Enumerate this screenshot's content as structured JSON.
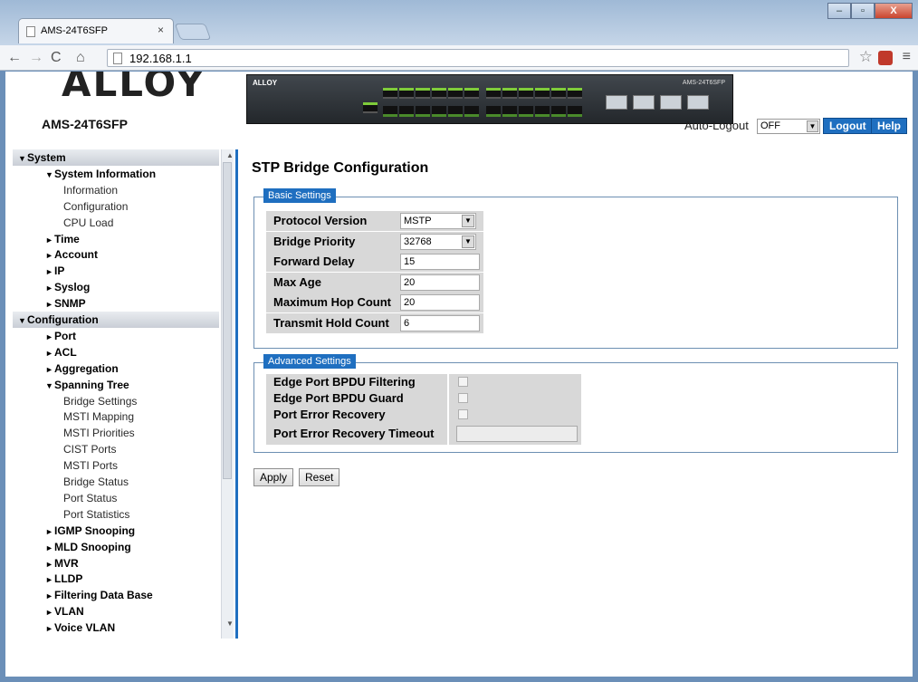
{
  "browser": {
    "tab_title": "AMS-24T6SFP",
    "tab_close": "×",
    "url": "192.168.1.1",
    "window_buttons": [
      "–",
      "▫",
      "X"
    ]
  },
  "header": {
    "logo_text": "ALLOY",
    "model": "AMS-24T6SFP",
    "device_logo": "ALLOY",
    "device_model": "AMS-24T6SFP",
    "auto_logout_label": "Auto-Logout",
    "auto_logout_value": "OFF",
    "logout_label": "Logout",
    "help_label": "Help"
  },
  "sidebar": {
    "items": [
      {
        "label": "System",
        "level": 0,
        "arrow": "▼"
      },
      {
        "label": "System Information",
        "level": 1,
        "arrow": "▼"
      },
      {
        "label": "Information",
        "level": 2,
        "arrow": ""
      },
      {
        "label": "Configuration",
        "level": 2,
        "arrow": ""
      },
      {
        "label": "CPU Load",
        "level": 2,
        "arrow": ""
      },
      {
        "label": "Time",
        "level": 1,
        "arrow": "►"
      },
      {
        "label": "Account",
        "level": 1,
        "arrow": "►"
      },
      {
        "label": "IP",
        "level": 1,
        "arrow": "►"
      },
      {
        "label": "Syslog",
        "level": 1,
        "arrow": "►"
      },
      {
        "label": "SNMP",
        "level": 1,
        "arrow": "►"
      },
      {
        "label": "Configuration",
        "level": 0,
        "arrow": "▼"
      },
      {
        "label": "Port",
        "level": 1,
        "arrow": "►"
      },
      {
        "label": "ACL",
        "level": 1,
        "arrow": "►"
      },
      {
        "label": "Aggregation",
        "level": 1,
        "arrow": "►"
      },
      {
        "label": "Spanning Tree",
        "level": 1,
        "arrow": "▼"
      },
      {
        "label": "Bridge Settings",
        "level": 2,
        "arrow": ""
      },
      {
        "label": "MSTI Mapping",
        "level": 2,
        "arrow": ""
      },
      {
        "label": "MSTI Priorities",
        "level": 2,
        "arrow": ""
      },
      {
        "label": "CIST Ports",
        "level": 2,
        "arrow": ""
      },
      {
        "label": "MSTI Ports",
        "level": 2,
        "arrow": ""
      },
      {
        "label": "Bridge Status",
        "level": 2,
        "arrow": ""
      },
      {
        "label": "Port Status",
        "level": 2,
        "arrow": ""
      },
      {
        "label": "Port Statistics",
        "level": 2,
        "arrow": ""
      },
      {
        "label": "IGMP Snooping",
        "level": 1,
        "arrow": "►"
      },
      {
        "label": "MLD Snooping",
        "level": 1,
        "arrow": "►"
      },
      {
        "label": "MVR",
        "level": 1,
        "arrow": "►"
      },
      {
        "label": "LLDP",
        "level": 1,
        "arrow": "►"
      },
      {
        "label": "Filtering Data Base",
        "level": 1,
        "arrow": "►"
      },
      {
        "label": "VLAN",
        "level": 1,
        "arrow": "►"
      },
      {
        "label": "Voice VLAN",
        "level": 1,
        "arrow": "►"
      }
    ]
  },
  "main": {
    "title": "STP Bridge Configuration",
    "basic": {
      "legend": "Basic Settings",
      "rows": [
        {
          "label": "Protocol Version",
          "value": "MSTP",
          "type": "select"
        },
        {
          "label": "Bridge Priority",
          "value": "32768",
          "type": "select"
        },
        {
          "label": "Forward Delay",
          "value": "15",
          "type": "text"
        },
        {
          "label": "Max Age",
          "value": "20",
          "type": "text"
        },
        {
          "label": "Maximum Hop Count",
          "value": "20",
          "type": "text"
        },
        {
          "label": "Transmit Hold Count",
          "value": "6",
          "type": "text"
        }
      ]
    },
    "advanced": {
      "legend": "Advanced Settings",
      "rows": [
        {
          "label": "Edge Port BPDU Filtering",
          "type": "checkbox",
          "checked": false
        },
        {
          "label": "Edge Port BPDU Guard",
          "type": "checkbox",
          "checked": false
        },
        {
          "label": "Port Error Recovery",
          "type": "checkbox",
          "checked": false
        },
        {
          "label": "Port Error Recovery Timeout",
          "type": "text",
          "value": ""
        }
      ]
    },
    "apply_label": "Apply",
    "reset_label": "Reset"
  },
  "colors": {
    "accent": "#1f6fc0",
    "label_bg": "#d8d8d8"
  }
}
